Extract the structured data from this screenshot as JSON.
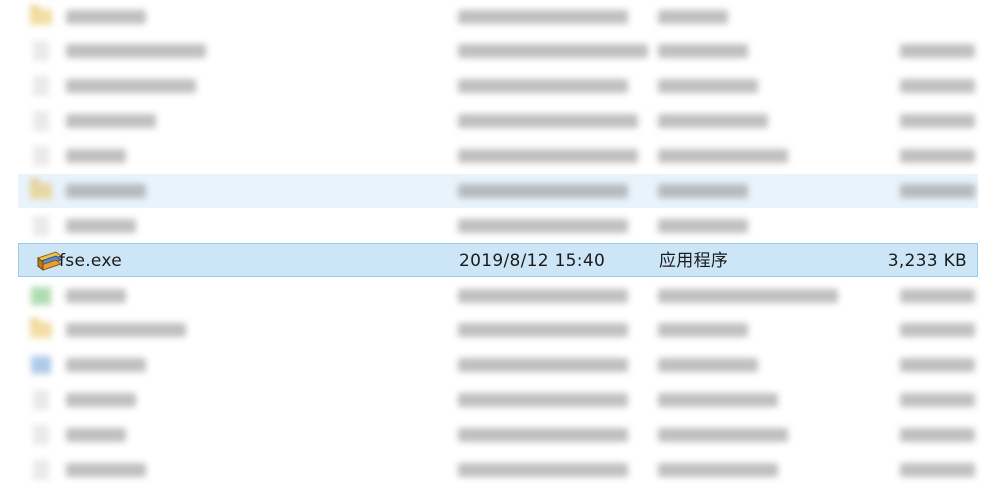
{
  "file_list": {
    "selected": {
      "name": "fse.exe",
      "modified": "2019/8/12 15:40",
      "type": "应用程序",
      "size": "3,233 KB",
      "icon": "exe-app-icon"
    }
  },
  "colors": {
    "selection_background": "#cce6f7",
    "selection_border": "#99ceef",
    "hover_background": "#e8f3fb",
    "folder_icon": "#e8c15a"
  }
}
